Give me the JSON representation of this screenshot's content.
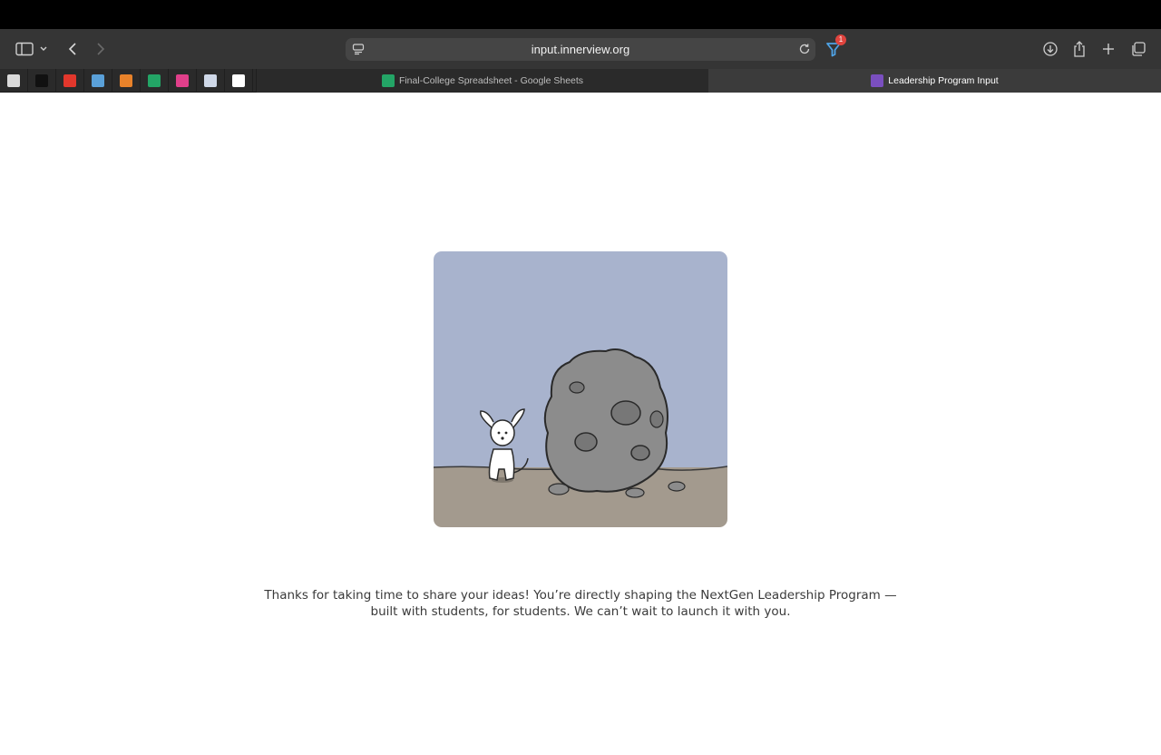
{
  "browser": {
    "url": "input.innerview.org",
    "extension_badge": "1",
    "pinned_tabs": [
      {
        "icon": "news-site-icon",
        "color": "#d9d9d9"
      },
      {
        "icon": "nbs-site-icon",
        "color": "#111111"
      },
      {
        "icon": "red-app-icon",
        "color": "#e2372c"
      },
      {
        "icon": "blue-app-icon",
        "color": "#5aa0d8"
      },
      {
        "icon": "orange-app-icon",
        "color": "#e8822a"
      },
      {
        "icon": "sheets-icon",
        "color": "#23a566"
      },
      {
        "icon": "t-app-icon",
        "color": "#e03f8a"
      },
      {
        "icon": "docs-icon",
        "color": "#cfd8e8"
      },
      {
        "icon": "colorful-app-icon",
        "color": "#ffffff"
      }
    ],
    "tabs": [
      {
        "title": "Final-College Spreadsheet - Google Sheets",
        "active": false
      },
      {
        "title": "Leadership Program Input",
        "active": true
      }
    ]
  },
  "page": {
    "message": "Thanks for taking  time to share your ideas! You’re directly shaping the NextGen Leadership Program — built with students, for students. We can’t wait to launch it with you."
  },
  "colors": {
    "sky": "#a8b3cd",
    "ground": "#a39a8e",
    "rock": "#8c8c8c",
    "accent_badge": "#e0443e",
    "extension": "#4fa3e6"
  }
}
